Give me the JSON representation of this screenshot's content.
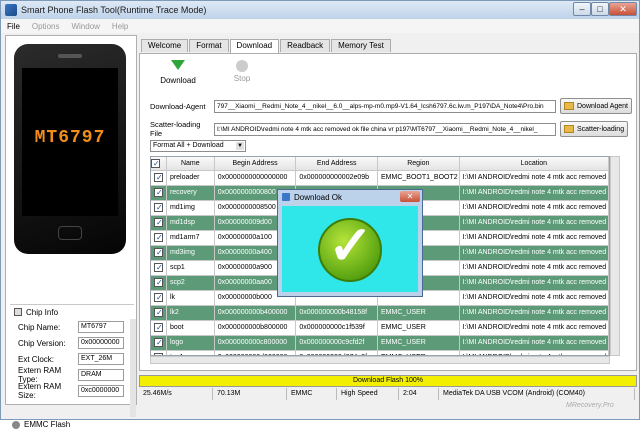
{
  "window": {
    "title": "Smart Phone Flash Tool(Runtime Trace Mode)",
    "btn_min": "–",
    "btn_max": "□",
    "btn_close": "✕"
  },
  "menu": [
    "File",
    "Options",
    "Window",
    "Help"
  ],
  "phone": {
    "chip": "MT6797"
  },
  "chip_info": {
    "header": "Chip Info",
    "rows": [
      {
        "label": "Chip Name:",
        "value": "MT6797"
      },
      {
        "label": "Chip Version:",
        "value": "0x00000000"
      },
      {
        "label": "Ext Clock:",
        "value": "EXT_26M"
      },
      {
        "label": "Extern RAM Type:",
        "value": "DRAM"
      },
      {
        "label": "Extern RAM Size:",
        "value": "0xc0000000"
      }
    ],
    "storage": "EMMC Flash"
  },
  "tabs": [
    "Welcome",
    "Format",
    "Download",
    "Readback",
    "Memory Test"
  ],
  "toolbar": {
    "download": "Download",
    "stop": "Stop"
  },
  "download_agent": {
    "label": "Download-Agent",
    "value": "797__Xiaomi__Redmi_Note_4__nikel__6.0__alps-mp-m0.mp9-V1.64_lcsh6797.6c.lw.m_P197\\DA_Note4\\Pro.bin",
    "button": "Download Agent"
  },
  "scatter": {
    "label": "Scatter-loading File",
    "value": "I:\\MI ANDROID\\redmi note 4 mtk acc removed ok file china vr p197\\MT6797__Xiaomi__Redmi_Note_4__nikel_",
    "button": "Scatter-loading"
  },
  "mode": "Format All + Download",
  "table": {
    "headers": [
      "Name",
      "Begin Address",
      "End Address",
      "Region",
      "Location"
    ],
    "rows": [
      {
        "name": "preloader",
        "begin": "0x0000000000000000",
        "end": "0x000000000002e09b",
        "region": "EMMC_BOOT1_BOOT2",
        "loc": "I:\\MI ANDROID\\redmi note 4 mtk acc removed o...",
        "style": "w"
      },
      {
        "name": "recovery",
        "begin": "0x0000000000800",
        "end": "",
        "region": "",
        "loc": "I:\\MI ANDROID\\redmi note 4 mtk acc removed o...",
        "style": "g"
      },
      {
        "name": "md1img",
        "begin": "0x0000000008500",
        "end": "",
        "region": "",
        "loc": "I:\\MI ANDROID\\redmi note 4 mtk acc removed o...",
        "style": "w"
      },
      {
        "name": "md1dsp",
        "begin": "0x000000009d00",
        "end": "",
        "region": "",
        "loc": "I:\\MI ANDROID\\redmi note 4 mtk acc removed o...",
        "style": "g"
      },
      {
        "name": "md1arm7",
        "begin": "0x00000000a100",
        "end": "",
        "region": "",
        "loc": "I:\\MI ANDROID\\redmi note 4 mtk acc removed o...",
        "style": "w"
      },
      {
        "name": "md3img",
        "begin": "0x00000000a400",
        "end": "",
        "region": "",
        "loc": "I:\\MI ANDROID\\redmi note 4 mtk acc removed o...",
        "style": "g"
      },
      {
        "name": "scp1",
        "begin": "0x00000000a900",
        "end": "",
        "region": "",
        "loc": "I:\\MI ANDROID\\redmi note 4 mtk acc removed o...",
        "style": "w"
      },
      {
        "name": "scp2",
        "begin": "0x00000000aa00",
        "end": "",
        "region": "",
        "loc": "I:\\MI ANDROID\\redmi note 4 mtk acc removed o...",
        "style": "g"
      },
      {
        "name": "lk",
        "begin": "0x00000000b000",
        "end": "",
        "region": "",
        "loc": "I:\\MI ANDROID\\redmi note 4 mtk acc removed o...",
        "style": "w"
      },
      {
        "name": "lk2",
        "begin": "0x000000000b400000",
        "end": "0x000000000b48158f",
        "region": "EMMC_USER",
        "loc": "I:\\MI ANDROID\\redmi note 4 mtk acc removed o...",
        "style": "g"
      },
      {
        "name": "boot",
        "begin": "0x000000000b800000",
        "end": "0x000000000c1f539f",
        "region": "EMMC_USER",
        "loc": "I:\\MI ANDROID\\redmi note 4 mtk acc removed o...",
        "style": "w"
      },
      {
        "name": "logo",
        "begin": "0x000000000c800000",
        "end": "0x000000000c9cfd2f",
        "region": "EMMC_USER",
        "loc": "I:\\MI ANDROID\\redmi note 4 mtk acc removed o...",
        "style": "g"
      },
      {
        "name": "tee1",
        "begin": "0x000000000d000000",
        "end": "0x000000000d074e9f",
        "region": "EMMC_USER",
        "loc": "I:\\MI ANDROID\\redmi note 4 mtk acc removed o...",
        "style": "w"
      }
    ]
  },
  "dialog": {
    "title": "Download Ok",
    "close": "✕",
    "mark": "✓"
  },
  "progress": {
    "text": "Download Flash 100%",
    "fraction": 1.0,
    "color": "#f2f000"
  },
  "status": [
    "25.46M/s",
    "70.13M",
    "EMMC",
    "High Speed",
    "2:04",
    "MediaTek DA USB VCOM (Android) (COM40)"
  ],
  "watermark": "MRecovery.Pro"
}
